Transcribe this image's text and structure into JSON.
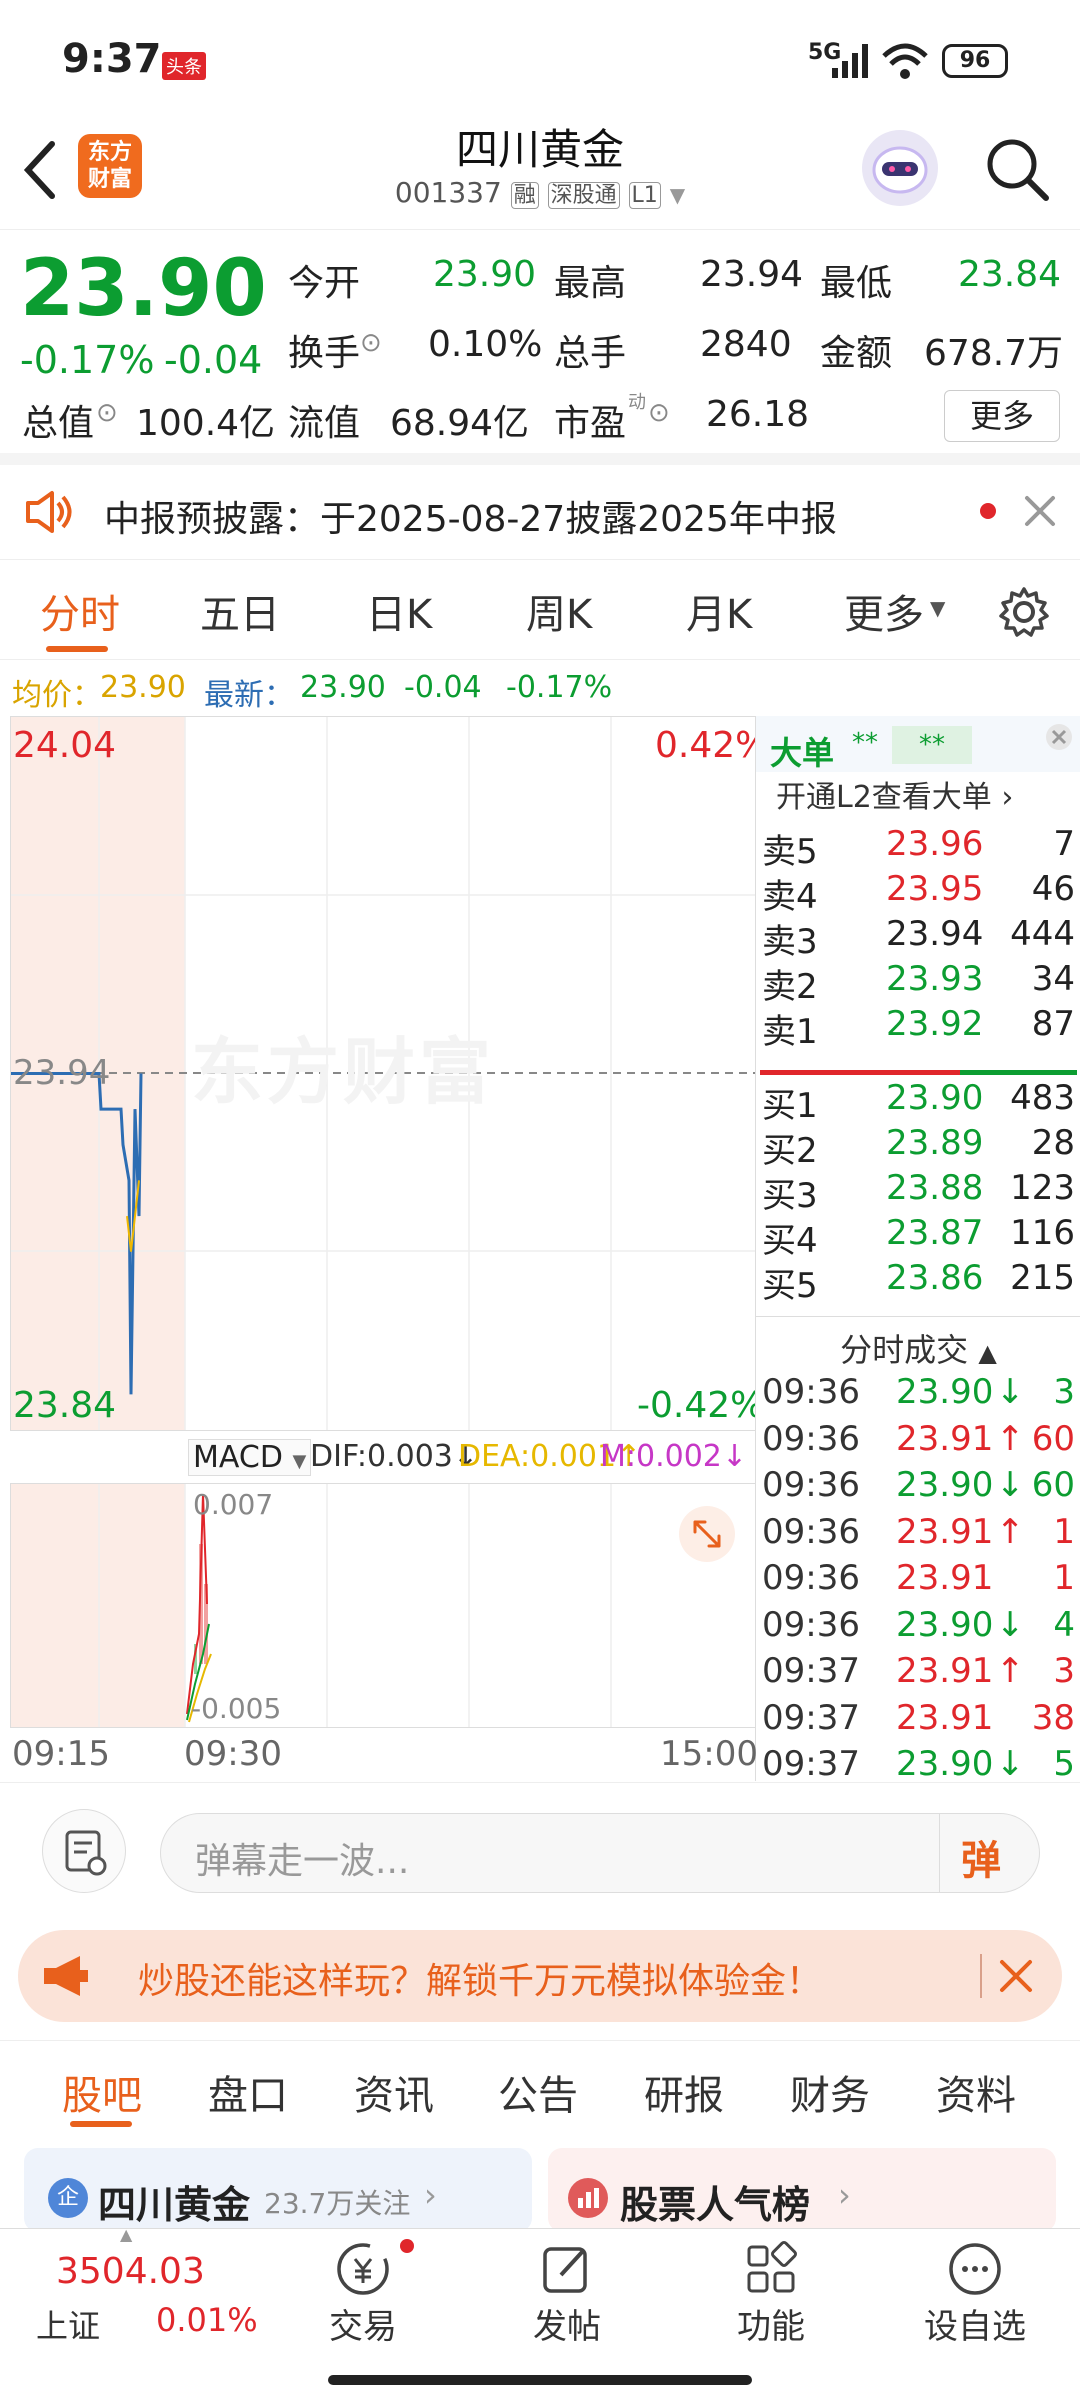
{
  "status_bar": {
    "time": "9:37",
    "toutiao_badge": "头条",
    "network": "5G",
    "battery": "96"
  },
  "header": {
    "back_icon": "back-arrow-icon",
    "app_logo_line1": "东方",
    "app_logo_line2": "财富",
    "title": "四川黄金",
    "code": "001337",
    "tags": [
      "融",
      "深股通",
      "L1"
    ]
  },
  "quote": {
    "price": "23.90",
    "change_pct": "-0.17%",
    "change": "-0.04",
    "fields": [
      {
        "label": "今开",
        "value": "23.90"
      },
      {
        "label": "最高",
        "value": "23.94"
      },
      {
        "label": "最低",
        "value": "23.84"
      },
      {
        "label": "换手",
        "value": "0.10%"
      },
      {
        "label": "总手",
        "value": "2840"
      },
      {
        "label": "金额",
        "value": "678.7万"
      },
      {
        "label": "总值",
        "value": "100.4亿"
      },
      {
        "label": "流值",
        "value": "68.94亿"
      },
      {
        "label": "市盈",
        "value": "26.18"
      }
    ],
    "pe_superscript": "动",
    "more_button": "更多"
  },
  "notice": {
    "text": "中报预披露：于2025-08-27披露2025年中报"
  },
  "tabs": [
    "分时",
    "五日",
    "日K",
    "周K",
    "月K",
    "更多"
  ],
  "info_line": {
    "avg_label": "均价：",
    "avg_value": "23.90",
    "latest_label": "最新：",
    "latest_value": "23.90",
    "latest_change": "-0.04",
    "latest_pct": "-0.17%"
  },
  "chart": {
    "y_top": "24.04",
    "y_mid": "23.94",
    "y_bottom": "23.84",
    "pct_top": "0.42%",
    "pct_bottom": "-0.42%",
    "watermark": "东方财富",
    "price_series": [
      23.94,
      23.94,
      23.94,
      23.94,
      23.93,
      23.93,
      23.92,
      23.91,
      23.85,
      23.93,
      23.9,
      23.94
    ],
    "avg_series": [
      23.9,
      23.89,
      23.9,
      23.91
    ]
  },
  "orderbook": {
    "title": "大单",
    "stars1": "**",
    "stars2": "**",
    "l2_link": "开通L2查看大单",
    "asks": [
      {
        "label": "卖5",
        "price": "23.96",
        "vol": "7",
        "color": "red"
      },
      {
        "label": "卖4",
        "price": "23.95",
        "vol": "46",
        "color": "red"
      },
      {
        "label": "卖3",
        "price": "23.94",
        "vol": "444",
        "color": "dark"
      },
      {
        "label": "卖2",
        "price": "23.93",
        "vol": "34",
        "color": "green"
      },
      {
        "label": "卖1",
        "price": "23.92",
        "vol": "87",
        "color": "green"
      }
    ],
    "bids": [
      {
        "label": "买1",
        "price": "23.90",
        "vol": "483",
        "color": "green"
      },
      {
        "label": "买2",
        "price": "23.89",
        "vol": "28",
        "color": "green"
      },
      {
        "label": "买3",
        "price": "23.88",
        "vol": "123",
        "color": "green"
      },
      {
        "label": "买4",
        "price": "23.87",
        "vol": "116",
        "color": "green"
      },
      {
        "label": "买5",
        "price": "23.86",
        "vol": "215",
        "color": "green"
      }
    ],
    "ticks_title": "分时成交",
    "ticks": [
      {
        "time": "09:36",
        "price": "23.90",
        "arrow": "↓",
        "vol": "3",
        "color": "green"
      },
      {
        "time": "09:36",
        "price": "23.91",
        "arrow": "↑",
        "vol": "60",
        "color": "red"
      },
      {
        "time": "09:36",
        "price": "23.90",
        "arrow": "↓",
        "vol": "60",
        "color": "green"
      },
      {
        "time": "09:36",
        "price": "23.91",
        "arrow": "↑",
        "vol": "1",
        "color": "red"
      },
      {
        "time": "09:36",
        "price": "23.91",
        "arrow": "",
        "vol": "1",
        "color": "red"
      },
      {
        "time": "09:36",
        "price": "23.90",
        "arrow": "↓",
        "vol": "4",
        "color": "green"
      },
      {
        "time": "09:37",
        "price": "23.91",
        "arrow": "↑",
        "vol": "3",
        "color": "red"
      },
      {
        "time": "09:37",
        "price": "23.91",
        "arrow": "",
        "vol": "38",
        "color": "red"
      },
      {
        "time": "09:37",
        "price": "23.90",
        "arrow": "↓",
        "vol": "5",
        "color": "green"
      }
    ]
  },
  "macd": {
    "selector": "MACD",
    "dif": "DIF:0.003",
    "dea": "DEA:0.001",
    "m": "M:0.002",
    "top": "0.007",
    "bottom": "-0.005"
  },
  "time_axis": {
    "start": "09:15",
    "open": "09:30",
    "end": "15:00"
  },
  "danmu": {
    "placeholder": "弹幕走一波...",
    "button": "弹"
  },
  "promo": {
    "text": "炒股还能这样玩？解锁千万元模拟体验金！"
  },
  "bottom_tabs": [
    "股吧",
    "盘口",
    "资讯",
    "公告",
    "研报",
    "财务",
    "资料"
  ],
  "cards": {
    "left_name": "四川黄金",
    "left_follow": "23.7万关注",
    "left_badge": "企",
    "right_name": "股票人气榜"
  },
  "bottom_nav": {
    "index_value": "3504.03",
    "index_name": "上证",
    "index_pct": "0.01%",
    "items": [
      "交易",
      "发帖",
      "功能",
      "设自选"
    ]
  },
  "colors": {
    "red": "#e0262b",
    "green": "#0c9d31",
    "orange": "#e8601c",
    "blue_line": "#2d6db3",
    "avg_line": "#f0b800"
  }
}
